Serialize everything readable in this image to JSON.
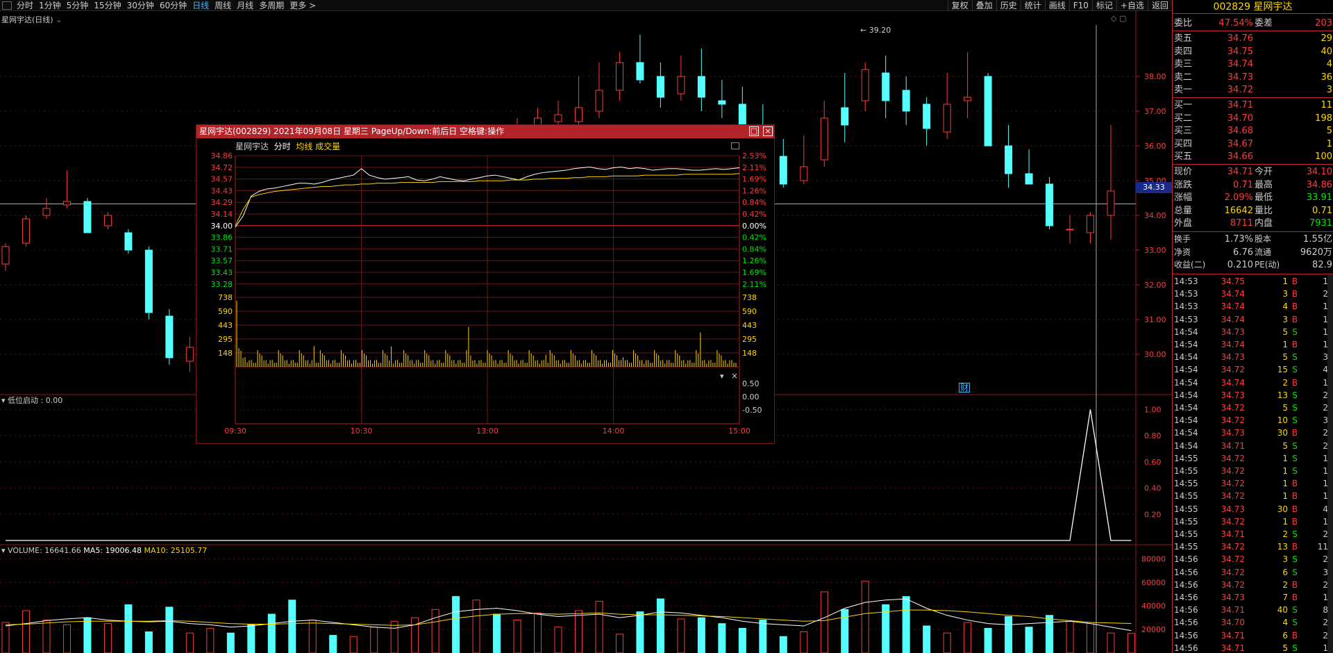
{
  "toolbar": {
    "periods": [
      "分时",
      "1分钟",
      "5分钟",
      "15分钟",
      "30分钟",
      "60分钟",
      "日线",
      "周线",
      "月线",
      "多周期",
      "更多 >"
    ],
    "active_period": "日线",
    "right_buttons": [
      "复权",
      "叠加",
      "历史",
      "统计",
      "画线",
      "F10",
      "标记",
      "+自选",
      "返回"
    ]
  },
  "main_chart": {
    "title": "星网宇达(日线)",
    "price_ticks": [
      "38.00",
      "37.00",
      "36.00",
      "35.00",
      "34.00",
      "33.00",
      "32.00",
      "31.00",
      "30.00"
    ],
    "current_price_label": "34.33",
    "high_label": "39.20",
    "event_marker": "财"
  },
  "indicator": {
    "label": "低位启动 : 0.00",
    "ticks": [
      "1.00",
      "0.80",
      "0.60",
      "0.40",
      "0.20"
    ]
  },
  "volume": {
    "label_vol": "VOLUME: 16641.66",
    "label_ma5": "MA5: 19006.48",
    "label_ma10": "MA10: 25105.77",
    "ticks": [
      "80000",
      "60000",
      "40000",
      "20000"
    ]
  },
  "popup": {
    "title": "星网宇达(002829) 2021年09月08日 星期三 PageUp/Down:前后日 空格键:操作",
    "name": "星网宇达",
    "tab_fenshi": "分时",
    "tab_avg": "均线",
    "tab_vol": "成交量",
    "left_prices": [
      "34.86",
      "34.72",
      "34.57",
      "34.43",
      "34.29",
      "34.14",
      "34.00",
      "33.86",
      "33.71",
      "33.57",
      "33.43",
      "33.28"
    ],
    "right_pcts": [
      "2.53%",
      "2.11%",
      "1.69%",
      "1.26%",
      "0.84%",
      "0.42%",
      "0.00%",
      "0.42%",
      "0.84%",
      "1.26%",
      "1.69%",
      "2.11%"
    ],
    "vol_ticks": [
      "738",
      "590",
      "443",
      "295",
      "148"
    ],
    "ind_ticks": [
      "0.50",
      "0.00",
      "-0.50"
    ],
    "times": [
      "09:30",
      "10:30",
      "13:00",
      "14:00",
      "15:00"
    ]
  },
  "quote": {
    "code": "002829",
    "name": "星网宇达",
    "weibi_label": "委比",
    "weibi": "47.54%",
    "weicha_label": "委差",
    "weicha": "203",
    "sells": [
      {
        "label": "卖五",
        "price": "34.76",
        "vol": "29"
      },
      {
        "label": "卖四",
        "price": "34.75",
        "vol": "40"
      },
      {
        "label": "卖三",
        "price": "34.74",
        "vol": "4"
      },
      {
        "label": "卖二",
        "price": "34.73",
        "vol": "36"
      },
      {
        "label": "卖一",
        "price": "34.72",
        "vol": "3"
      }
    ],
    "buys": [
      {
        "label": "买一",
        "price": "34.71",
        "vol": "11"
      },
      {
        "label": "买二",
        "price": "34.70",
        "vol": "198"
      },
      {
        "label": "买三",
        "price": "34.68",
        "vol": "5"
      },
      {
        "label": "买四",
        "price": "34.67",
        "vol": "1"
      },
      {
        "label": "买五",
        "price": "34.66",
        "vol": "100"
      }
    ],
    "stats": [
      {
        "l1": "现价",
        "v1": "34.71",
        "c1": "#ff3b3b",
        "l2": "今开",
        "v2": "34.10",
        "c2": "#ff3b3b"
      },
      {
        "l1": "涨跌",
        "v1": "0.71",
        "c1": "#ff3b3b",
        "l2": "最高",
        "v2": "34.86",
        "c2": "#ff3b3b"
      },
      {
        "l1": "涨幅",
        "v1": "2.09%",
        "c1": "#ff3b3b",
        "l2": "最低",
        "v2": "33.91",
        "c2": "#00e600"
      },
      {
        "l1": "总量",
        "v1": "16642",
        "c1": "#ffd700",
        "l2": "量比",
        "v2": "0.71",
        "c2": "#ffd700"
      },
      {
        "l1": "外盘",
        "v1": "8711",
        "c1": "#ff3b3b",
        "l2": "内盘",
        "v2": "7931",
        "c2": "#00e600"
      }
    ],
    "stats2": [
      {
        "l1": "换手",
        "v1": "1.73%",
        "l2": "股本",
        "v2": "1.55亿"
      },
      {
        "l1": "净资",
        "v1": "6.76",
        "l2": "流通",
        "v2": "9620万"
      },
      {
        "l1": "收益(二)",
        "v1": "0.210",
        "l2": "PE(动)",
        "v2": "82.9"
      }
    ]
  },
  "ticks": [
    {
      "t": "14:53",
      "p": "34.75",
      "v": "1",
      "d": "B",
      "n": "1"
    },
    {
      "t": "14:53",
      "p": "34.74",
      "v": "3",
      "d": "B",
      "n": "2"
    },
    {
      "t": "14:53",
      "p": "34.74",
      "v": "4",
      "d": "B",
      "n": "1"
    },
    {
      "t": "14:53",
      "p": "34.74",
      "v": "3",
      "d": "B",
      "n": "1"
    },
    {
      "t": "14:54",
      "p": "34.73",
      "v": "5",
      "d": "S",
      "n": "1"
    },
    {
      "t": "14:54",
      "p": "34.74",
      "v": "1",
      "d": "B",
      "n": "1"
    },
    {
      "t": "14:54",
      "p": "34.73",
      "v": "5",
      "d": "S",
      "n": "3"
    },
    {
      "t": "14:54",
      "p": "34.72",
      "v": "15",
      "d": "S",
      "n": "4"
    },
    {
      "t": "14:54",
      "p": "34.74",
      "v": "2",
      "d": "B",
      "n": "1"
    },
    {
      "t": "14:54",
      "p": "34.73",
      "v": "13",
      "d": "S",
      "n": "2"
    },
    {
      "t": "14:54",
      "p": "34.72",
      "v": "5",
      "d": "S",
      "n": "2"
    },
    {
      "t": "14:54",
      "p": "34.72",
      "v": "10",
      "d": "S",
      "n": "3"
    },
    {
      "t": "14:54",
      "p": "34.73",
      "v": "30",
      "d": "B",
      "n": "2"
    },
    {
      "t": "14:54",
      "p": "34.71",
      "v": "5",
      "d": "S",
      "n": "2"
    },
    {
      "t": "14:55",
      "p": "34.72",
      "v": "1",
      "d": "S",
      "n": "1"
    },
    {
      "t": "14:55",
      "p": "34.72",
      "v": "1",
      "d": "S",
      "n": "1"
    },
    {
      "t": "14:55",
      "p": "34.72",
      "v": "1",
      "d": "B",
      "n": "1"
    },
    {
      "t": "14:55",
      "p": "34.72",
      "v": "1",
      "d": "B",
      "n": "1"
    },
    {
      "t": "14:55",
      "p": "34.73",
      "v": "30",
      "d": "B",
      "n": "4"
    },
    {
      "t": "14:55",
      "p": "34.72",
      "v": "1",
      "d": "B",
      "n": "1"
    },
    {
      "t": "14:55",
      "p": "34.71",
      "v": "2",
      "d": "S",
      "n": "2"
    },
    {
      "t": "14:55",
      "p": "34.72",
      "v": "13",
      "d": "B",
      "n": "11"
    },
    {
      "t": "14:56",
      "p": "34.72",
      "v": "3",
      "d": "S",
      "n": "2"
    },
    {
      "t": "14:56",
      "p": "34.72",
      "v": "6",
      "d": "S",
      "n": "3"
    },
    {
      "t": "14:56",
      "p": "34.72",
      "v": "2",
      "d": "B",
      "n": "2"
    },
    {
      "t": "14:56",
      "p": "34.73",
      "v": "7",
      "d": "B",
      "n": "1"
    },
    {
      "t": "14:56",
      "p": "34.71",
      "v": "40",
      "d": "S",
      "n": "8"
    },
    {
      "t": "14:56",
      "p": "34.70",
      "v": "4",
      "d": "S",
      "n": "2"
    },
    {
      "t": "14:56",
      "p": "34.71",
      "v": "6",
      "d": "B",
      "n": "2"
    },
    {
      "t": "14:56",
      "p": "34.71",
      "v": "5",
      "d": "S",
      "n": "1"
    }
  ],
  "colors": {
    "up": "#ff3b3b",
    "down": "#54ffff",
    "border": "#c0262b",
    "title_bar": "#b3242a",
    "active": "#3fb7ff",
    "yellow": "#ffd700",
    "green": "#00e600"
  },
  "chart_data": {
    "type": "candlestick",
    "candles": [
      [
        32.6,
        33.1,
        32.4,
        33.2
      ],
      [
        33.2,
        33.9,
        33.1,
        34.0
      ],
      [
        34.0,
        34.2,
        33.9,
        34.5
      ],
      [
        34.3,
        34.4,
        34.2,
        35.3
      ],
      [
        34.4,
        33.5,
        33.5,
        34.5
      ],
      [
        33.7,
        34.0,
        33.6,
        34.1
      ],
      [
        33.5,
        33.0,
        32.9,
        33.6
      ],
      [
        33.0,
        31.2,
        31.0,
        33.1
      ],
      [
        31.1,
        29.9,
        29.7,
        31.3
      ],
      [
        29.8,
        30.2,
        29.5,
        30.5
      ],
      [
        30.3,
        30.4,
        29.9,
        30.5
      ],
      [
        30.5,
        30.1,
        29.6,
        30.6
      ],
      [
        30.1,
        30.0,
        29.6,
        30.3
      ],
      [
        30.0,
        29.9,
        29.6,
        30.2
      ],
      [
        30.1,
        29.5,
        29.4,
        30.2
      ],
      [
        29.7,
        29.9,
        29.4,
        30.0
      ],
      [
        29.8,
        29.6,
        29.3,
        29.9
      ],
      [
        29.3,
        29.6,
        29.2,
        29.9
      ],
      [
        29.5,
        29.8,
        29.3,
        29.9
      ],
      [
        29.8,
        29.8,
        29.4,
        29.9
      ],
      [
        32.0,
        34.2,
        31.9,
        34.5
      ],
      [
        34.2,
        35.0,
        33.9,
        35.1
      ],
      [
        35.2,
        35.0,
        34.6,
        35.9
      ],
      [
        35.0,
        36.3,
        34.9,
        36.4
      ],
      [
        36.2,
        35.6,
        35.4,
        36.6
      ],
      [
        35.6,
        36.5,
        35.5,
        36.8
      ],
      [
        36.4,
        36.8,
        36.2,
        37.1
      ],
      [
        36.7,
        36.9,
        36.4,
        37.3
      ],
      [
        36.7,
        37.1,
        36.5,
        38.0
      ],
      [
        37.0,
        37.6,
        36.8,
        38.4
      ],
      [
        37.6,
        38.4,
        37.3,
        38.7
      ],
      [
        38.4,
        37.9,
        37.8,
        39.2
      ],
      [
        38.0,
        37.4,
        37.1,
        38.4
      ],
      [
        37.5,
        38.0,
        37.3,
        38.6
      ],
      [
        38.0,
        37.4,
        37.0,
        38.8
      ],
      [
        37.3,
        37.2,
        36.8,
        37.9
      ],
      [
        37.2,
        36.6,
        36.4,
        37.7
      ],
      [
        36.6,
        35.8,
        35.5,
        37.2
      ],
      [
        35.7,
        34.9,
        34.8,
        36.2
      ],
      [
        35.0,
        35.4,
        34.9,
        36.3
      ],
      [
        35.6,
        36.8,
        35.4,
        37.3
      ],
      [
        37.1,
        36.6,
        36.1,
        38.1
      ],
      [
        37.3,
        38.2,
        37.0,
        38.4
      ],
      [
        38.1,
        37.3,
        36.8,
        38.6
      ],
      [
        37.6,
        37.0,
        36.6,
        38.0
      ],
      [
        37.2,
        36.5,
        36.0,
        37.4
      ],
      [
        36.4,
        37.2,
        36.2,
        38.1
      ],
      [
        37.3,
        37.4,
        36.8,
        38.7
      ],
      [
        38.0,
        36.0,
        36.0,
        38.1
      ],
      [
        36.0,
        35.2,
        34.8,
        36.6
      ],
      [
        35.2,
        34.9,
        34.9,
        35.9
      ],
      [
        34.9,
        33.7,
        33.6,
        35.1
      ],
      [
        33.6,
        33.6,
        33.2,
        34.0
      ],
      [
        33.5,
        34.0,
        33.2,
        34.1
      ],
      [
        34.0,
        34.7,
        33.3,
        36.6
      ]
    ],
    "volume_values": [
      26000,
      36000,
      28000,
      24000,
      30000,
      25000,
      41000,
      18000,
      39000,
      17000,
      21000,
      17000,
      24000,
      33000,
      45000,
      28000,
      15000,
      14000,
      22000,
      27000,
      30000,
      37000,
      48000,
      45000,
      33000,
      28000,
      34000,
      22000,
      36000,
      44000,
      16000,
      35000,
      46000,
      29000,
      30000,
      25000,
      21000,
      28000,
      14000,
      18000,
      52000,
      37000,
      61000,
      41000,
      48000,
      23000,
      17000,
      26000,
      21000,
      31000,
      22000,
      32000,
      27000,
      26000,
      17000,
      16642
    ],
    "ma5": [
      23000,
      25000,
      27500,
      29000,
      30000,
      28000,
      27000,
      26500,
      27000,
      25000,
      24000,
      22000,
      23000,
      25000,
      27000,
      28000,
      26000,
      24000,
      22000,
      21000,
      24000,
      30000,
      35000,
      37000,
      38000,
      36000,
      33000,
      31000,
      32000,
      33000,
      30000,
      32000,
      35000,
      34000,
      32000,
      30000,
      27000,
      25000,
      24000,
      23000,
      30000,
      38000,
      43000,
      45000,
      46000,
      38000,
      32000,
      28000,
      25000,
      24000,
      25000,
      26000,
      27000,
      25000,
      22000,
      19006.48
    ],
    "ma10": [
      24000,
      24500,
      25500,
      26500,
      27000,
      27000,
      27000,
      27000,
      27500,
      27000,
      26000,
      25000,
      24500,
      24500,
      25000,
      25500,
      25000,
      24500,
      24000,
      23500,
      24000,
      26500,
      29500,
      31500,
      33000,
      33500,
      33500,
      33000,
      33500,
      34000,
      33000,
      32500,
      32500,
      32000,
      31500,
      31000,
      30000,
      29000,
      28000,
      27000,
      27500,
      30500,
      33500,
      35000,
      36500,
      36500,
      36000,
      35000,
      33500,
      32000,
      31000,
      29000,
      27500,
      26000,
      25500,
      25105.77
    ],
    "indicator_values": [
      0,
      0,
      0,
      0,
      0,
      0,
      0,
      0,
      0,
      0,
      0,
      0,
      0,
      0,
      0,
      0,
      0,
      0,
      0,
      0,
      0,
      0,
      0,
      0,
      0,
      0,
      0,
      0,
      0,
      0,
      0,
      0,
      0,
      0,
      0,
      0,
      0,
      0,
      0,
      0,
      0,
      0,
      0,
      0,
      0,
      0,
      0,
      0,
      0,
      0,
      0,
      0,
      0,
      1.0,
      0,
      0
    ],
    "popup_price": [
      33.98,
      34.12,
      34.36,
      34.42,
      34.45,
      34.46,
      34.48,
      34.5,
      34.52,
      34.52,
      34.51,
      34.53,
      34.56,
      34.58,
      34.6,
      34.62,
      34.7,
      34.62,
      34.59,
      34.57,
      34.58,
      34.59,
      34.6,
      34.56,
      34.55,
      34.57,
      34.6,
      34.58,
      34.56,
      34.55,
      34.57,
      34.59,
      34.61,
      34.62,
      34.6,
      34.58,
      34.56,
      34.6,
      34.63,
      34.65,
      34.66,
      34.67,
      34.68,
      34.7,
      34.71,
      34.72,
      34.7,
      34.69,
      34.71,
      34.72,
      34.7,
      34.71,
      34.7,
      34.68,
      34.69,
      34.7,
      34.7,
      34.69,
      34.68,
      34.68,
      34.69,
      34.7,
      34.69,
      34.7,
      34.71
    ],
    "popup_avg": [
      34.0,
      34.2,
      34.35,
      34.38,
      34.4,
      34.42,
      34.43,
      34.44,
      34.45,
      34.46,
      34.47,
      34.48,
      34.48,
      34.49,
      34.5,
      34.5,
      34.51,
      34.51,
      34.52,
      34.52,
      34.52,
      34.53,
      34.53,
      34.53,
      34.53,
      34.53,
      34.54,
      34.54,
      34.54,
      34.54,
      34.54,
      34.55,
      34.55,
      34.55,
      34.55,
      34.56,
      34.56,
      34.56,
      34.57,
      34.57,
      34.58,
      34.58,
      34.58,
      34.59,
      34.59,
      34.6,
      34.6,
      34.6,
      34.61,
      34.61,
      34.61,
      34.61,
      34.62,
      34.62,
      34.62,
      34.62,
      34.62,
      34.63,
      34.63,
      34.63,
      34.63,
      34.63,
      34.63,
      34.63,
      34.64
    ]
  }
}
